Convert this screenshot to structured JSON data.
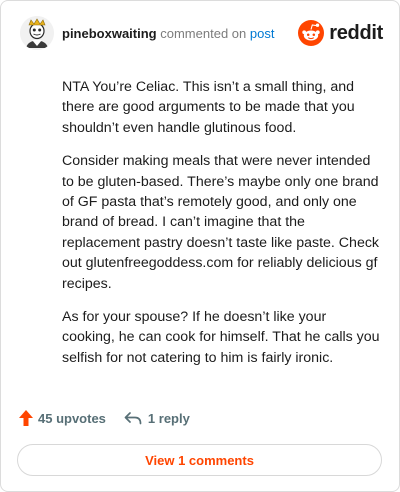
{
  "header": {
    "username": "pineboxwaiting",
    "action_text": "commented on",
    "post_link": "post",
    "brand": "reddit"
  },
  "comment": {
    "paragraphs": [
      "NTA You’re Celiac. This isn’t a small thing, and there are good arguments to be made that you shouldn’t even handle glutinous food.",
      "Consider making meals that were never intended to be gluten-based. There’s maybe only one brand of GF pasta that’s remotely good, and only one brand of bread. I can’t imagine that the replacement pastry doesn’t taste like paste. Check out glutenfreegoddess.com for reliably delicious gf recipes.",
      "As for your spouse? If he doesn’t like your cooking, he can cook for himself. That he calls you selfish for not catering to him is fairly ironic."
    ]
  },
  "actions": {
    "upvotes": "45 upvotes",
    "replies": "1 reply"
  },
  "view_comments_label": "View 1 comments",
  "colors": {
    "brand_orange": "#ff4500",
    "link_blue": "#0079d3",
    "meta_gray": "#7c7c7c"
  },
  "icons": [
    "avatar",
    "reddit-snoo-icon",
    "upvote-arrow-icon",
    "reply-arrow-icon"
  ]
}
